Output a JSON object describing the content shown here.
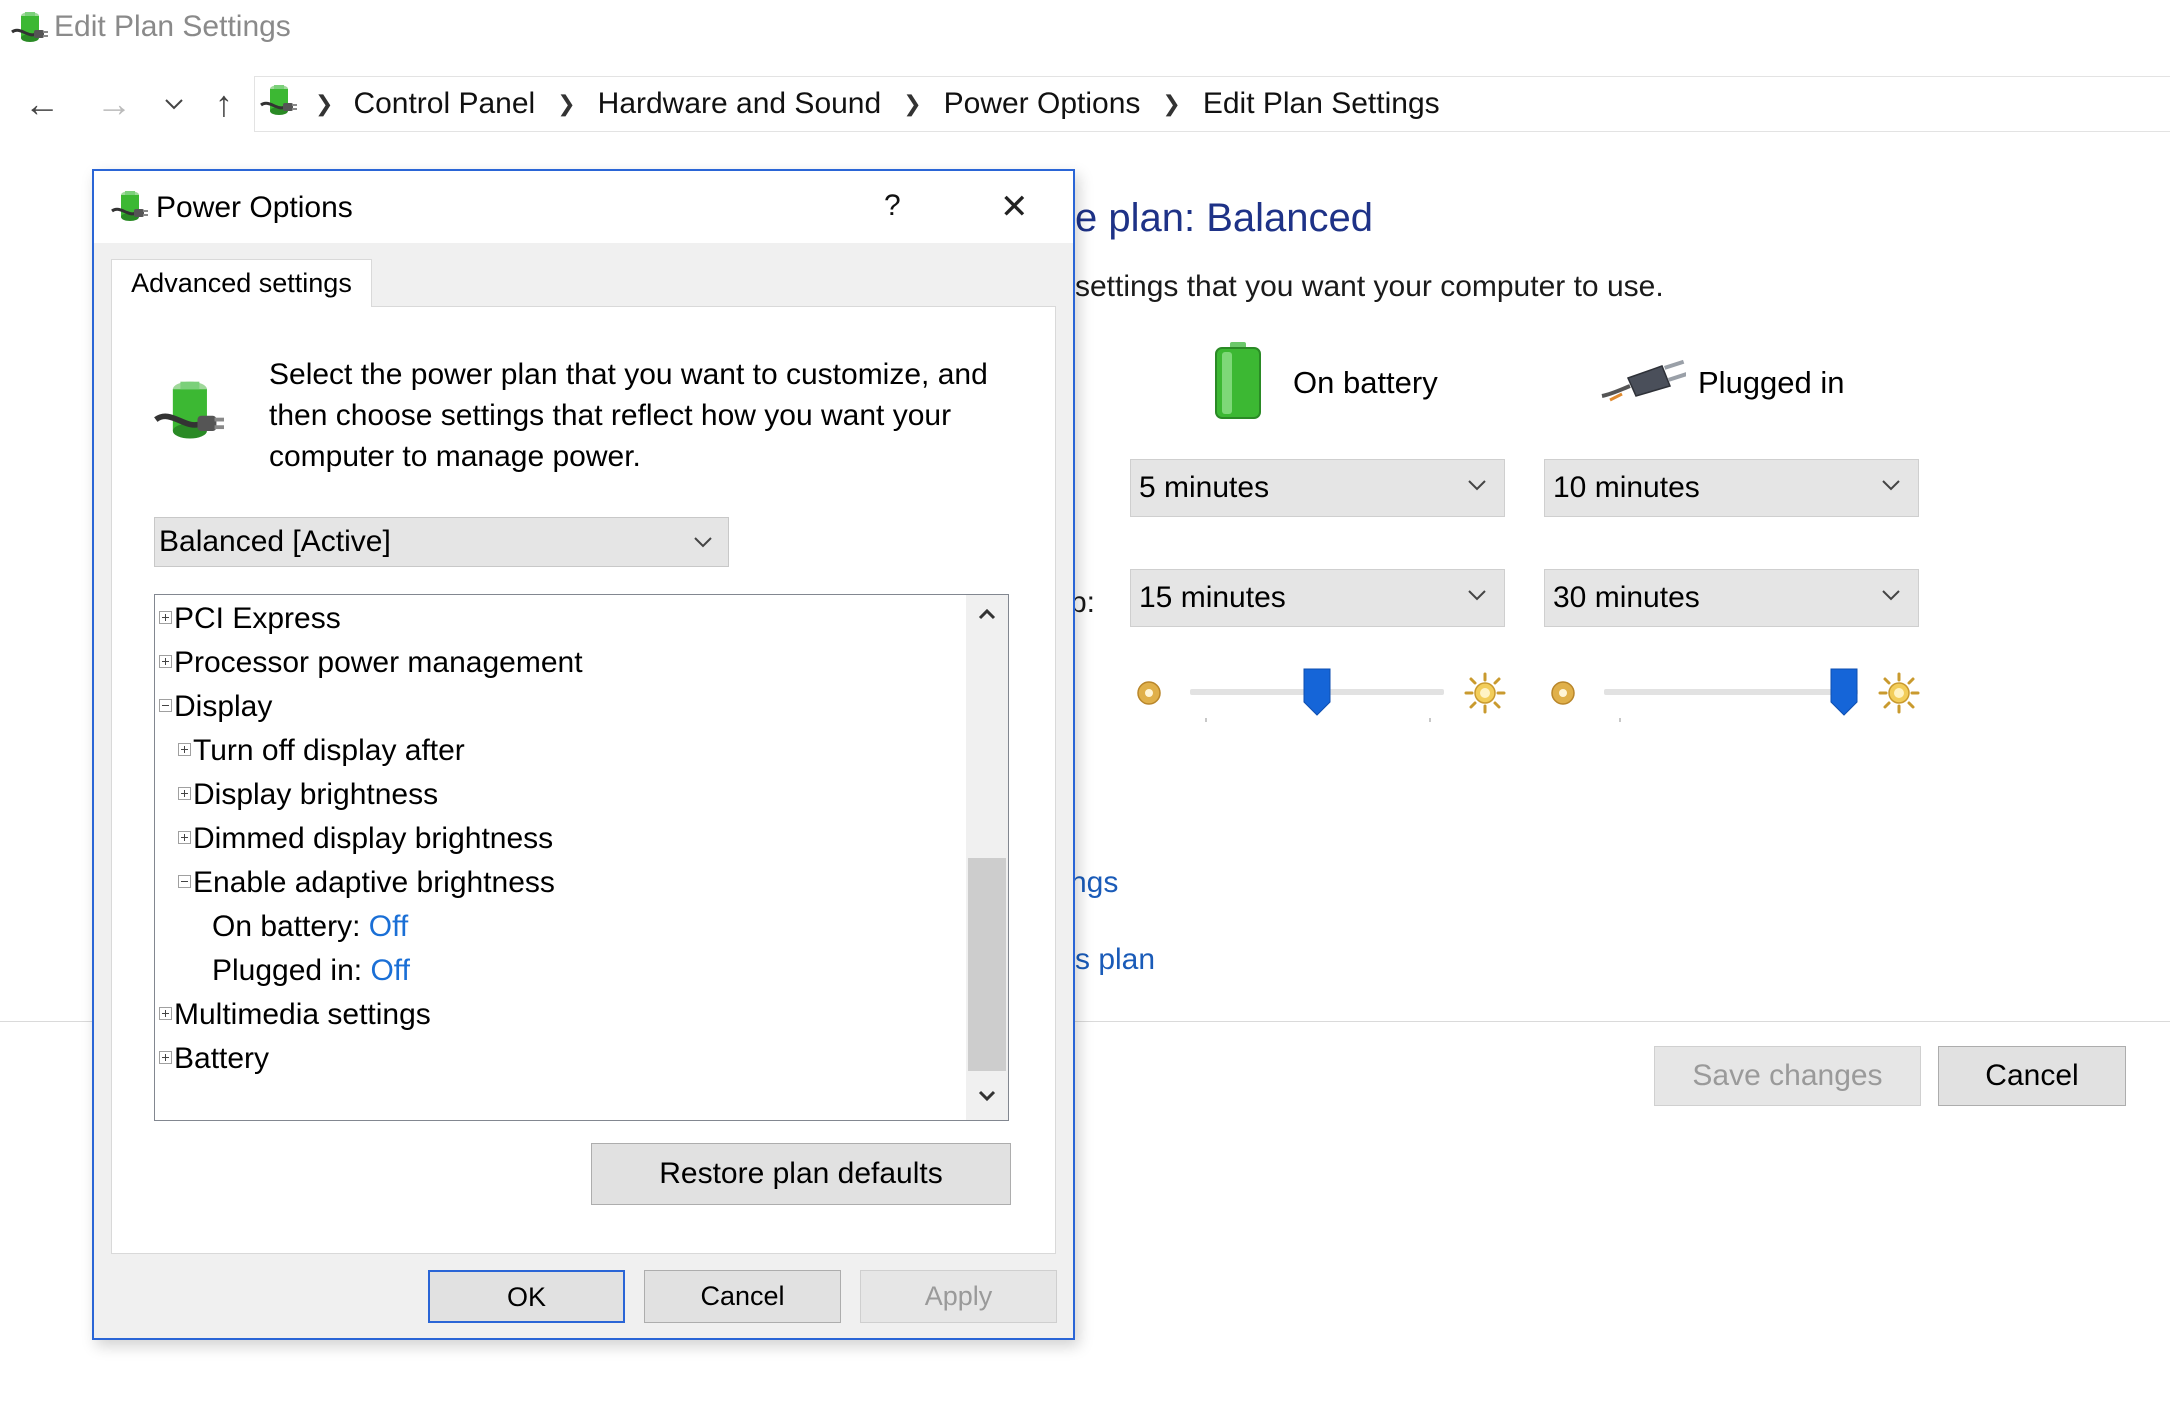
{
  "window": {
    "title": "Edit Plan Settings"
  },
  "nav": {
    "back_glyph": "←",
    "forward_glyph": "→",
    "up_glyph": "↑",
    "breadcrumbs": [
      {
        "label": "Control Panel"
      },
      {
        "label": "Hardware and Sound"
      },
      {
        "label": "Power Options"
      },
      {
        "label": "Edit Plan Settings"
      }
    ]
  },
  "page": {
    "heading_fragment": "e plan: Balanced",
    "description_fragment": "settings that you want your computer to use.",
    "columns": {
      "on_battery": "On battery",
      "plugged_in": "Plugged in"
    },
    "row_label_fragment": "p:",
    "settings": {
      "dim_display": {
        "on_battery": "5 minutes",
        "plugged_in": "10 minutes"
      },
      "sleep": {
        "on_battery": "15 minutes",
        "plugged_in": "30 minutes"
      },
      "brightness": {
        "on_battery": 0.5,
        "plugged_in": 1.0
      }
    },
    "link_advanced_fragment": "ngs",
    "link_restore_fragment": "s plan",
    "save_changes": "Save changes",
    "cancel": "Cancel"
  },
  "dialog": {
    "title": "Power Options",
    "help_glyph": "?",
    "close_glyph": "✕",
    "tab": "Advanced settings",
    "description": "Select the power plan that you want to customize, and then choose settings that reflect how you want your computer to manage power.",
    "plan_selected": "Balanced [Active]",
    "tree": {
      "pci_express": "PCI Express",
      "processor_power": "Processor power management",
      "display": "Display",
      "turn_off_display": "Turn off display after",
      "display_brightness": "Display brightness",
      "dimmed_brightness": "Dimmed display brightness",
      "adaptive_brightness": "Enable adaptive brightness",
      "on_battery_label": "On battery:",
      "on_battery_value": "Off",
      "plugged_in_label": "Plugged in:",
      "plugged_in_value": "Off",
      "multimedia": "Multimedia settings",
      "battery": "Battery"
    },
    "restore_defaults": "Restore plan defaults",
    "ok": "OK",
    "cancel": "Cancel",
    "apply": "Apply"
  },
  "colors": {
    "accent": "#2a65d6",
    "link": "#1a6fd6",
    "heading": "#1e3287",
    "battery_green": "#3cb833"
  },
  "icons": [
    "power-options-icon",
    "back-arrow-icon",
    "forward-arrow-icon",
    "recent-chevron-icon",
    "up-arrow-icon",
    "breadcrumb-separator-icon",
    "battery-icon",
    "plug-icon",
    "chevron-down-icon",
    "brightness-low-icon",
    "brightness-high-icon",
    "tree-expand-icon",
    "tree-collapse-icon",
    "scroll-up-icon",
    "scroll-down-icon",
    "help-icon",
    "close-icon"
  ]
}
